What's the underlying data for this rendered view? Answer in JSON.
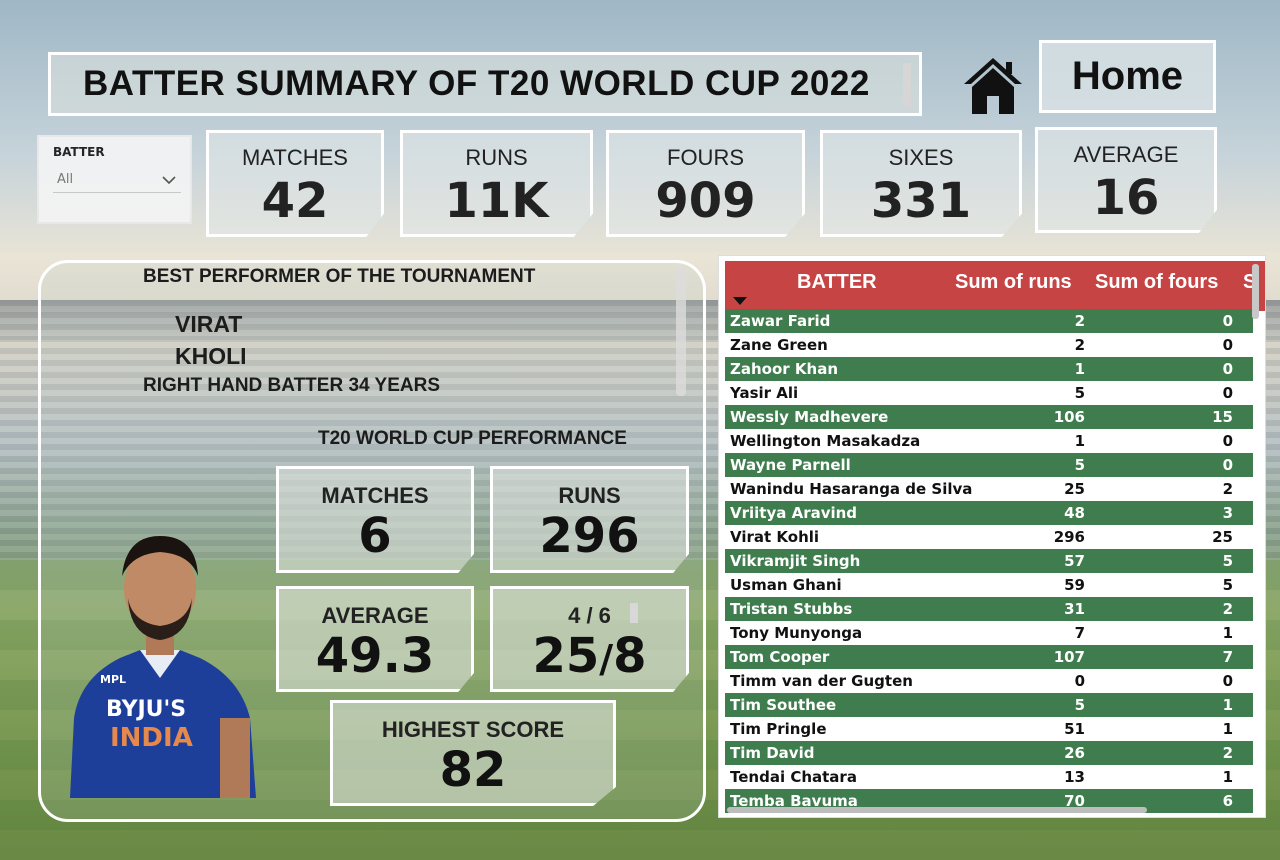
{
  "title": "BATTER SUMMARY OF T20 WORLD CUP 2022",
  "home_label": "Home",
  "slicer": {
    "label": "BATTER",
    "value": "All"
  },
  "kpis": [
    {
      "label": "MATCHES",
      "value": "42"
    },
    {
      "label": "RUNS",
      "value": "11K"
    },
    {
      "label": "FOURS",
      "value": "909"
    },
    {
      "label": "SIXES",
      "value": "331"
    },
    {
      "label": "AVERAGE",
      "value": "16"
    }
  ],
  "best": {
    "heading": "BEST PERFORMER OF THE TOURNAMENT",
    "first_name": "VIRAT",
    "last_name": "KHOLI",
    "role": "RIGHT HAND BATTER 34 YEARS",
    "wc_heading": "T20 WORLD CUP PERFORMANCE",
    "matches_label": "MATCHES",
    "matches": "6",
    "runs_label": "RUNS",
    "runs": "296",
    "average_label": "AVERAGE",
    "average": "49.3",
    "boundary_label": "4 / 6",
    "fours": "25",
    "slash": "/",
    "sixes": "8",
    "highest_label": "HIGHEST SCORE",
    "highest": "82",
    "jersey_brand": "BYJU'S",
    "jersey_team": "INDIA",
    "jersey_sponsor": "MPL"
  },
  "table": {
    "headers": [
      "BATTER",
      "Sum of runs",
      "Sum of fours",
      "S"
    ],
    "rows": [
      [
        "Zawar Farid",
        "2",
        "0"
      ],
      [
        "Zane Green",
        "2",
        "0"
      ],
      [
        "Zahoor Khan",
        "1",
        "0"
      ],
      [
        "Yasir Ali",
        "5",
        "0"
      ],
      [
        "Wessly Madhevere",
        "106",
        "15"
      ],
      [
        "Wellington Masakadza",
        "1",
        "0"
      ],
      [
        "Wayne Parnell",
        "5",
        "0"
      ],
      [
        "Wanindu Hasaranga de Silva",
        "25",
        "2"
      ],
      [
        "Vriitya Aravind",
        "48",
        "3"
      ],
      [
        "Virat Kohli",
        "296",
        "25"
      ],
      [
        "Vikramjit Singh",
        "57",
        "5"
      ],
      [
        "Usman Ghani",
        "59",
        "5"
      ],
      [
        "Tristan Stubbs",
        "31",
        "2"
      ],
      [
        "Tony Munyonga",
        "7",
        "1"
      ],
      [
        "Tom Cooper",
        "107",
        "7"
      ],
      [
        "Timm van der Gugten",
        "0",
        "0"
      ],
      [
        "Tim Southee",
        "5",
        "1"
      ],
      [
        "Tim Pringle",
        "51",
        "1"
      ],
      [
        "Tim David",
        "26",
        "2"
      ],
      [
        "Tendai Chatara",
        "13",
        "1"
      ],
      [
        "Temba Bavuma",
        "70",
        "6"
      ]
    ]
  }
}
